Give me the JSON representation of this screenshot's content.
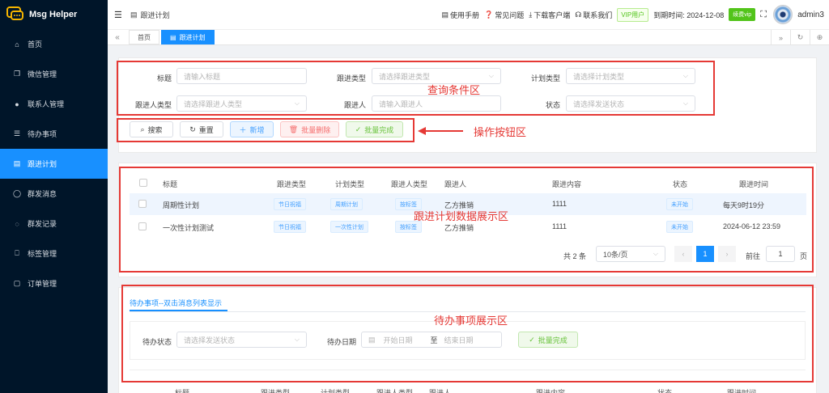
{
  "app": {
    "name": "Msg Helper"
  },
  "sidebar": {
    "items": [
      {
        "label": "首页",
        "icon": "home-icon"
      },
      {
        "label": "微信管理",
        "icon": "copy-icon"
      },
      {
        "label": "联系人管理",
        "icon": "user-icon"
      },
      {
        "label": "待办事项",
        "icon": "list-icon"
      },
      {
        "label": "跟进计划",
        "icon": "calendar-icon",
        "active": true
      },
      {
        "label": "群发消息",
        "icon": "chat-icon"
      },
      {
        "label": "群发记录",
        "icon": "chat-dots-icon"
      },
      {
        "label": "标签管理",
        "icon": "bookmark-icon"
      },
      {
        "label": "订单管理",
        "icon": "bag-icon"
      }
    ]
  },
  "header": {
    "breadcrumb": "跟进计划",
    "links": [
      "使用手册",
      "常见问题",
      "下载客户端",
      "联系我们"
    ],
    "vip": "VIP用户",
    "expire": "到期时间: 2024-12-08",
    "renew": "续费vip",
    "user": "admin3"
  },
  "tabs": [
    "首页",
    "跟进计划"
  ],
  "query": {
    "title_label": "标题",
    "title_ph": "请输入标题",
    "type_label": "跟进类型",
    "type_ph": "请选择跟进类型",
    "plan_label": "计划类型",
    "plan_ph": "请选择计划类型",
    "person_type_label": "跟进人类型",
    "person_type_ph": "请选择跟进人类型",
    "person_label": "跟进人",
    "person_ph": "请输入跟进人",
    "status_label": "状态",
    "status_ph": "请选择发送状态"
  },
  "actions": {
    "search": "搜索",
    "reset": "重置",
    "add": "新增",
    "batch_delete": "批量删除",
    "batch_done": "批量完成"
  },
  "table": {
    "headers": [
      "标题",
      "跟进类型",
      "计划类型",
      "跟进人类型",
      "跟进人",
      "跟进内容",
      "状态",
      "跟进时间"
    ],
    "rows": [
      [
        "周期性计划",
        "节日祝福",
        "周期计划",
        "按标签",
        "乙方推销",
        "1111",
        "未开始",
        "每天9时19分"
      ],
      [
        "一次性计划测试",
        "节日祝福",
        "一次性计划",
        "按标签",
        "乙方推销",
        "1111",
        "未开始",
        "2024-06-12 23:59"
      ]
    ]
  },
  "pager": {
    "total": "共 2 条",
    "size": "10条/页",
    "page": "1",
    "goto": "前往",
    "goto_value": "1",
    "unit": "页"
  },
  "todo": {
    "tab": "待办事项--双击消息列表显示",
    "status_label": "待办状态",
    "status_ph": "请选择发送状态",
    "date_label": "待办日期",
    "start_ph": "开始日期",
    "sep": "至",
    "end_ph": "结束日期",
    "batch_done": "批量完成",
    "headers": [
      "标题",
      "跟进类型",
      "计划类型",
      "跟进人类型",
      "跟进人",
      "跟进内容",
      "状态",
      "跟进时间"
    ]
  },
  "annotations": {
    "query": "查询条件区",
    "actions": "操作按钮区",
    "data": "跟进计划数据展示区",
    "todo": "待办事项展示区"
  }
}
